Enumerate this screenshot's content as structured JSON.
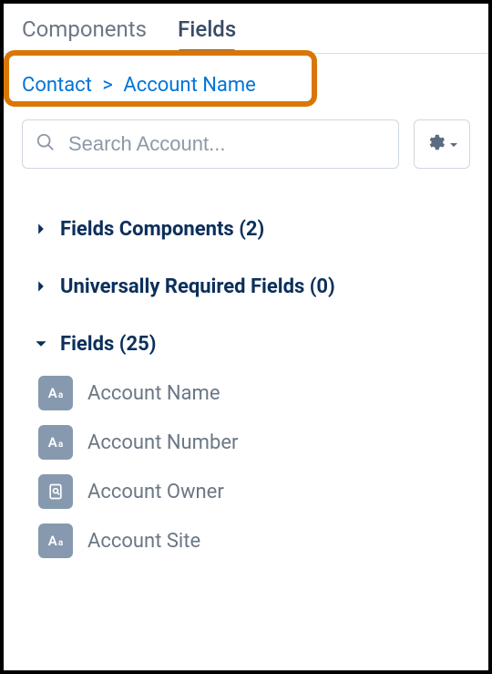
{
  "tabs": {
    "components": "Components",
    "fields": "Fields"
  },
  "breadcrumb": {
    "root": "Contact",
    "separator": ">",
    "current": "Account Name"
  },
  "search": {
    "placeholder": "Search Account..."
  },
  "sections": {
    "components": {
      "title": "Fields Components",
      "count": "(2)"
    },
    "required": {
      "title": "Universally Required Fields",
      "count": "(0)"
    },
    "fields": {
      "title": "Fields",
      "count": "(25)"
    }
  },
  "field_items": [
    {
      "label": "Account Name",
      "icon": "text"
    },
    {
      "label": "Account Number",
      "icon": "text"
    },
    {
      "label": "Account Owner",
      "icon": "lookup"
    },
    {
      "label": "Account Site",
      "icon": "text"
    }
  ]
}
